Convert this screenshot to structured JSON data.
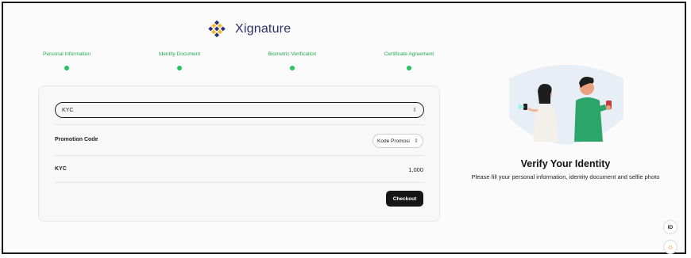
{
  "app": {
    "brand": "Xignature"
  },
  "steps": [
    {
      "label": "Personal Information"
    },
    {
      "label": "Identity Document"
    },
    {
      "label": "Biometric Verification"
    },
    {
      "label": "Certificate Agreement"
    }
  ],
  "form": {
    "product_select": {
      "value": "KYC"
    },
    "promotion": {
      "label": "Promotion Code",
      "select_value": "Kode Promosi"
    },
    "summary": {
      "label": "KYC",
      "amount": "1,000"
    },
    "checkout_label": "Checkout"
  },
  "panel": {
    "title": "Verify Your Identity",
    "subtitle": "Please fill your personal information, identity document and selfie photo"
  },
  "corner": {
    "language": "ID",
    "theme_icon": "sun-icon"
  },
  "colors": {
    "accent_green": "#22c55e",
    "brand_navy": "#2b2f6b",
    "brand_gold": "#f5b82e",
    "button_dark": "#161616"
  }
}
